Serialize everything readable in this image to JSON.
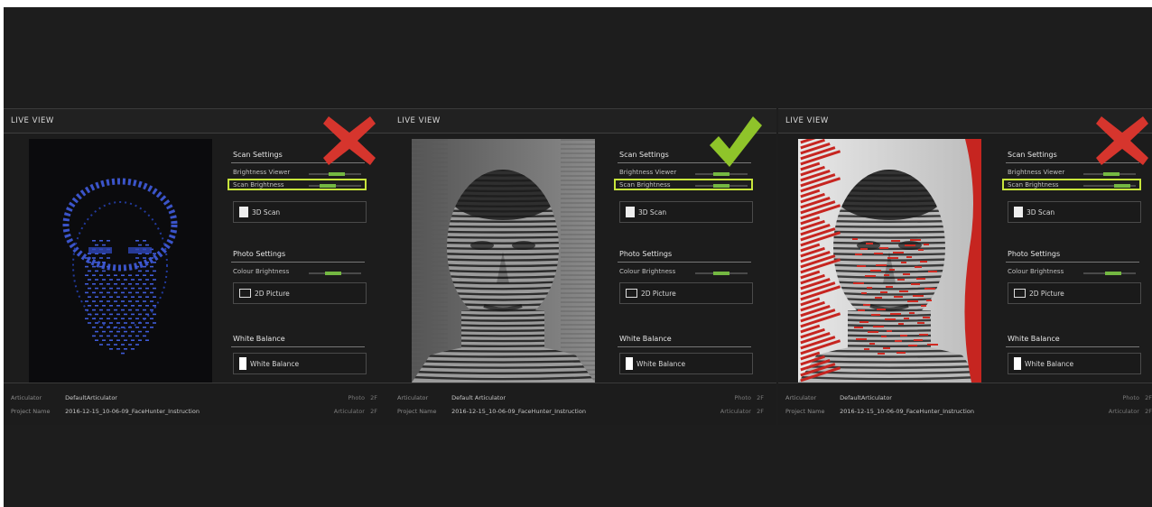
{
  "panels": [
    {
      "title": "LIVE VIEW",
      "variant": "blue-dots",
      "verdict": "cross",
      "scan_settings": {
        "title": "Scan Settings",
        "brightness_viewer_label": "Brightness Viewer",
        "brightness_viewer_level": 0.55,
        "scan_brightness_label": "Scan Brightness",
        "scan_brightness_level": 0.3,
        "button_label": "3D Scan"
      },
      "photo_settings": {
        "title": "Photo Settings",
        "colour_brightness_label": "Colour Brightness",
        "colour_brightness_level": 0.45,
        "button_label": "2D Picture"
      },
      "white_balance": {
        "title": "White Balance",
        "button_label": "White Balance"
      },
      "footer": {
        "articulator_key": "Articulator",
        "articulator_value": "DefaultArticulator",
        "project_key": "Project Name",
        "project_value": "2016-12-15_10-06-09_FaceHunter_Instruction",
        "photo_label": "Photo",
        "photo_value": "2F",
        "articulator_right_label": "Articulator",
        "articulator_right_value": "2F"
      }
    },
    {
      "title": "LIVE VIEW",
      "variant": "good",
      "verdict": "check",
      "scan_settings": {
        "title": "Scan Settings",
        "brightness_viewer_label": "Brightness Viewer",
        "brightness_viewer_level": 0.5,
        "scan_brightness_label": "Scan Brightness",
        "scan_brightness_level": 0.5,
        "button_label": "3D Scan"
      },
      "photo_settings": {
        "title": "Photo Settings",
        "colour_brightness_label": "Colour Brightness",
        "colour_brightness_level": 0.5,
        "button_label": "2D Picture"
      },
      "white_balance": {
        "title": "White Balance",
        "button_label": "White Balance"
      },
      "footer": {
        "articulator_key": "Articulator",
        "articulator_value": "Default Articulator",
        "project_key": "Project Name",
        "project_value": "2016-12-15_10-06-09_FaceHunter_Instruction",
        "photo_label": "Photo",
        "photo_value": "2F",
        "articulator_right_label": "Articulator",
        "articulator_right_value": "2F"
      }
    },
    {
      "title": "LIVE VIEW",
      "variant": "red-overexposed",
      "verdict": "cross",
      "scan_settings": {
        "title": "Scan Settings",
        "brightness_viewer_label": "Brightness Viewer",
        "brightness_viewer_level": 0.55,
        "scan_brightness_label": "Scan Brightness",
        "scan_brightness_level": 0.85,
        "button_label": "3D Scan"
      },
      "photo_settings": {
        "title": "Photo Settings",
        "colour_brightness_label": "Colour Brightness",
        "colour_brightness_level": 0.6,
        "button_label": "2D Picture"
      },
      "white_balance": {
        "title": "White Balance",
        "button_label": "White Balance"
      },
      "footer": {
        "articulator_key": "Articulator",
        "articulator_value": "DefaultArticulator",
        "project_key": "Project Name",
        "project_value": "2016-12-15_10-06-09_FaceHunter_Instruction",
        "photo_label": "Photo",
        "photo_value": "2F",
        "articulator_right_label": "Articulator",
        "articulator_right_value": "2F"
      }
    }
  ],
  "colors": {
    "highlight": "#c7e43c",
    "slider_fill": "#74b842",
    "cross": "#d6352d",
    "check": "#8fc42a"
  }
}
